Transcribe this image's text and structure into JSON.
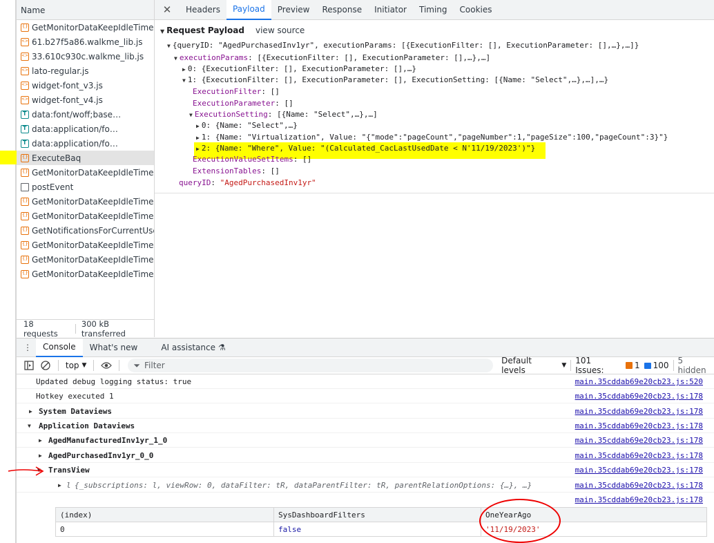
{
  "network": {
    "name_header": "Name",
    "requests": [
      {
        "label": "GetMonitorDataKeepIdleTime",
        "icon": "xhr-icon"
      },
      {
        "label": "61.b27f5a86.walkme_lib.js",
        "icon": "script-icon"
      },
      {
        "label": "33.610c930c.walkme_lib.js",
        "icon": "script-icon"
      },
      {
        "label": "lato-regular.js",
        "icon": "script-icon"
      },
      {
        "label": "widget-font_v3.js",
        "icon": "script-icon"
      },
      {
        "label": "widget-font_v4.js",
        "icon": "script-icon"
      },
      {
        "label": "data:font/woff;base…",
        "icon": "font-icon"
      },
      {
        "label": "data:application/fo…",
        "icon": "font-icon"
      },
      {
        "label": "data:application/fo…",
        "icon": "font-icon"
      },
      {
        "label": "ExecuteBaq",
        "icon": "xhr-icon",
        "selected": true
      },
      {
        "label": "GetMonitorDataKeepIdleTime",
        "icon": "xhr-icon"
      },
      {
        "label": "postEvent",
        "icon": "document-icon"
      },
      {
        "label": "GetMonitorDataKeepIdleTime",
        "icon": "xhr-icon"
      },
      {
        "label": "GetMonitorDataKeepIdleTime",
        "icon": "xhr-icon"
      },
      {
        "label": "GetNotificationsForCurrentUse…",
        "icon": "xhr-icon"
      },
      {
        "label": "GetMonitorDataKeepIdleTime",
        "icon": "xhr-icon"
      },
      {
        "label": "GetMonitorDataKeepIdleTime",
        "icon": "xhr-icon"
      },
      {
        "label": "GetMonitorDataKeepIdleTime",
        "icon": "xhr-icon"
      }
    ],
    "footer_requests": "18 requests",
    "footer_transferred": "300 kB transferred"
  },
  "detail_tabs": {
    "close": "✕",
    "headers": "Headers",
    "payload": "Payload",
    "preview": "Preview",
    "response": "Response",
    "initiator": "Initiator",
    "timing": "Timing",
    "cookies": "Cookies"
  },
  "payload": {
    "title": "Request Payload",
    "view_source": "view source",
    "lines": {
      "root": "{queryID: \"AgedPurchasedInv1yr\", executionParams: [{ExecutionFilter: [], ExecutionParameter: [],…},…]}",
      "exec_key": "executionParams",
      "exec_val": ": [{ExecutionFilter: [], ExecutionParameter: [],…},…]",
      "item0": "0: {ExecutionFilter: [], ExecutionParameter: [],…}",
      "item1": "1: {ExecutionFilter: [], ExecutionParameter: [], ExecutionSetting: [{Name: \"Select\",…},…],…}",
      "ef_key": "ExecutionFilter",
      "ef_val": ": []",
      "ep_key": "ExecutionParameter",
      "ep_val": ": []",
      "es_key": "ExecutionSetting",
      "es_val": ": [{Name: \"Select\",…},…]",
      "es0": "0: {Name: \"Select\",…}",
      "es1": "1: {Name: \"Virtualization\", Value: \"{\"mode\":\"pageCount\",\"pageNumber\":1,\"pageSize\":100,\"pageCount\":3}\"}",
      "es2": "2: {Name: \"Where\", Value: \"(Calculated_CacLastUsedDate < N'11/19/2023')\"}",
      "evsi_key": "ExecutionValueSetItems",
      "evsi_val": ": []",
      "ext_key": "ExtensionTables",
      "ext_val": ": []",
      "qid_key": "queryID",
      "qid_val": "\"AgedPurchasedInv1yr\""
    }
  },
  "console_tabs": {
    "console": "Console",
    "whats_new": "What's new",
    "ai": "AI assistance"
  },
  "console_toolbar": {
    "context": "top",
    "filter_placeholder": "Filter",
    "levels": "Default levels",
    "issues": "101 Issues:",
    "issues_warn": "1",
    "issues_info": "100",
    "hidden": "5 hidden"
  },
  "console": {
    "rows": [
      {
        "msg": "Updated debug logging status: true",
        "src": "main.35cddab69e20cb23.js:520"
      },
      {
        "msg": "Hotkey executed 1",
        "src": "main.35cddab69e20cb23.js:178"
      },
      {
        "msg": "System Dataviews",
        "src": "main.35cddab69e20cb23.js:178"
      },
      {
        "msg": "Application Dataviews",
        "src": "main.35cddab69e20cb23.js:178"
      },
      {
        "msg": "AgedManufacturedInv1yr_1_0",
        "src": "main.35cddab69e20cb23.js:178"
      },
      {
        "msg": "AgedPurchasedInv1yr_0_0",
        "src": "main.35cddab69e20cb23.js:178"
      },
      {
        "msg": "TransView",
        "src": "main.35cddab69e20cb23.js:178"
      },
      {
        "msg": "{_subscriptions: l, viewRow: 0, dataFilter: tR, dataParentFilter: tR, parentRelationOptions: {…}, …}",
        "prefix": "l",
        "src": "main.35cddab69e20cb23.js:178"
      },
      {
        "msg": "",
        "src": "main.35cddab69e20cb23.js:178"
      }
    ],
    "table": {
      "headers": [
        "(index)",
        "SysDashboardFilters",
        "OneYearAgo"
      ],
      "row": [
        "0",
        "false",
        "'11/19/2023'"
      ]
    }
  }
}
